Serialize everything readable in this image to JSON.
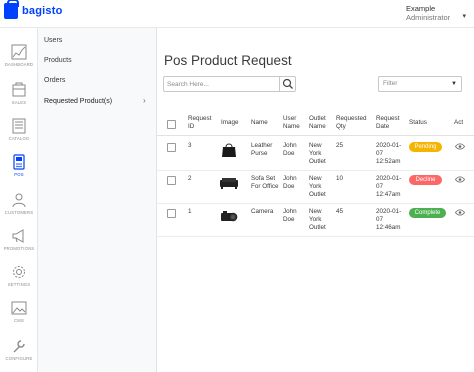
{
  "brand": {
    "logo_text": "bagisto",
    "accent_color": "#0041ff"
  },
  "user": {
    "name": "Example",
    "role": "Administrator"
  },
  "nav": [
    {
      "label": "DASHBOARD",
      "icon": "dashboard-icon"
    },
    {
      "label": "SALES",
      "icon": "sales-icon"
    },
    {
      "label": "CATALOG",
      "icon": "catalog-icon"
    },
    {
      "label": "POS",
      "icon": "pos-icon",
      "active": true
    },
    {
      "label": "CUSTOMERS",
      "icon": "customers-icon"
    },
    {
      "label": "PROMOTIONS",
      "icon": "promotions-icon"
    },
    {
      "label": "SETTINGS",
      "icon": "settings-icon"
    },
    {
      "label": "CMS",
      "icon": "cms-icon"
    },
    {
      "label": "CONFIGURE",
      "icon": "configure-icon"
    }
  ],
  "submenu": [
    {
      "label": "Users"
    },
    {
      "label": "Products"
    },
    {
      "label": "Orders"
    },
    {
      "label": "Requested Product(s)",
      "active": true
    }
  ],
  "page": {
    "title": "Pos Product Request"
  },
  "search": {
    "placeholder": "Search Here..."
  },
  "filter": {
    "placeholder": "Filter"
  },
  "table": {
    "columns": {
      "request_id": "Request ID",
      "image": "Image",
      "name": "Name",
      "user_name": "User Name",
      "outlet_name": "Outlet Name",
      "requested_qty": "Requested Qty",
      "request_date": "Request Date",
      "status": "Status",
      "actions": "Act"
    },
    "rows": [
      {
        "id": "3",
        "image": "handbag",
        "name": "Leather Purse",
        "user": "John Doe",
        "outlet": "New York Outlet",
        "qty": "25",
        "date": "2020-01-07 12:52am",
        "status": "Pending",
        "status_color": "#f5b400"
      },
      {
        "id": "2",
        "image": "sofa",
        "name": "Sofa Set For Office",
        "user": "John Doe",
        "outlet": "New York Outlet",
        "qty": "10",
        "date": "2020-01-07 12:47am",
        "status": "Decline",
        "status_color": "#fc6868"
      },
      {
        "id": "1",
        "image": "camera",
        "name": "Camera",
        "user": "John Doe",
        "outlet": "New York Outlet",
        "qty": "45",
        "date": "2020-01-07 12:46am",
        "status": "Complete",
        "status_color": "#4caf50"
      }
    ]
  }
}
